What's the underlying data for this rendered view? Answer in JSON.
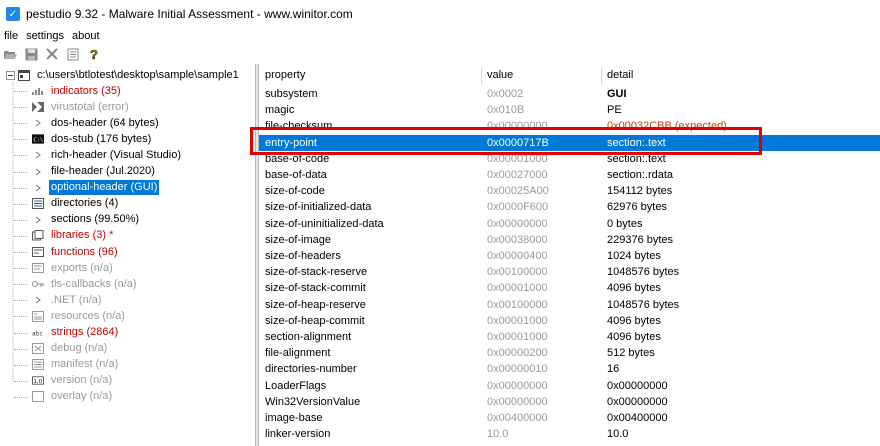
{
  "window": {
    "title": "pestudio 9.32 - Malware Initial Assessment - www.winitor.com"
  },
  "menu": [
    "file",
    "settings",
    "about"
  ],
  "tree": {
    "root": "c:\\users\\btlotest\\desktop\\sample\\sample1",
    "items": [
      {
        "label": "indicators (35)",
        "style": "red",
        "icon": "indicators-icon"
      },
      {
        "label": "virustotal (error)",
        "style": "gray",
        "icon": "virustotal-icon"
      },
      {
        "label": "dos-header (64 bytes)",
        "style": "normal",
        "icon": "expander-icon"
      },
      {
        "label": "dos-stub (176 bytes)",
        "style": "normal",
        "icon": "console-icon"
      },
      {
        "label": "rich-header (Visual Studio)",
        "style": "normal",
        "icon": "expander-icon"
      },
      {
        "label": "file-header (Jul.2020)",
        "style": "normal",
        "icon": "expander-icon"
      },
      {
        "label": "optional-header (GUI)",
        "style": "selected",
        "icon": "expander-icon"
      },
      {
        "label": "directories (4)",
        "style": "normal",
        "icon": "directories-icon"
      },
      {
        "label": "sections (99.50%)",
        "style": "normal",
        "icon": "expander-icon"
      },
      {
        "label": "libraries (3) *",
        "style": "red",
        "icon": "libraries-icon"
      },
      {
        "label": "functions (96)",
        "style": "red",
        "icon": "functions-icon"
      },
      {
        "label": "exports (n/a)",
        "style": "gray",
        "icon": "exports-icon"
      },
      {
        "label": "tls-callbacks (n/a)",
        "style": "gray",
        "icon": "tls-callbacks-icon"
      },
      {
        "label": ".NET (n/a)",
        "style": "gray",
        "icon": "expander-icon"
      },
      {
        "label": "resources (n/a)",
        "style": "gray",
        "icon": "resources-icon"
      },
      {
        "label": "strings (2864)",
        "style": "red",
        "icon": "strings-icon"
      },
      {
        "label": "debug (n/a)",
        "style": "gray",
        "icon": "debug-icon"
      },
      {
        "label": "manifest (n/a)",
        "style": "gray",
        "icon": "manifest-icon"
      },
      {
        "label": "version (n/a)",
        "style": "gray",
        "icon": "version-icon"
      },
      {
        "label": "overlay (n/a)",
        "style": "gray",
        "icon": "overlay-icon"
      }
    ]
  },
  "table": {
    "headers": [
      "property",
      "value",
      "detail"
    ],
    "rows": [
      {
        "property": "subsystem",
        "value": "0x0002",
        "detail": "GUI",
        "detail_bold": true
      },
      {
        "property": "magic",
        "value": "0x010B",
        "detail": "PE"
      },
      {
        "property": "file-checksum",
        "value": "0x00000000",
        "detail": "0x00032CBB (expected)",
        "detail_red": true
      },
      {
        "property": "entry-point",
        "value": "0x0000717B",
        "detail": "section:.text",
        "selected": true
      },
      {
        "property": "base-of-code",
        "value": "0x00001000",
        "detail": "section:.text"
      },
      {
        "property": "base-of-data",
        "value": "0x00027000",
        "detail": "section:.rdata"
      },
      {
        "property": "size-of-code",
        "value": "0x00025A00",
        "detail": "154112 bytes"
      },
      {
        "property": "size-of-initialized-data",
        "value": "0x0000F600",
        "detail": "62976 bytes"
      },
      {
        "property": "size-of-uninitialized-data",
        "value": "0x00000000",
        "detail": "0 bytes"
      },
      {
        "property": "size-of-image",
        "value": "0x00038000",
        "detail": "229376 bytes"
      },
      {
        "property": "size-of-headers",
        "value": "0x00000400",
        "detail": "1024 bytes"
      },
      {
        "property": "size-of-stack-reserve",
        "value": "0x00100000",
        "detail": "1048576 bytes"
      },
      {
        "property": "size-of-stack-commit",
        "value": "0x00001000",
        "detail": "4096 bytes"
      },
      {
        "property": "size-of-heap-reserve",
        "value": "0x00100000",
        "detail": "1048576 bytes"
      },
      {
        "property": "size-of-heap-commit",
        "value": "0x00001000",
        "detail": "4096 bytes"
      },
      {
        "property": "section-alignment",
        "value": "0x00001000",
        "detail": "4096 bytes"
      },
      {
        "property": "file-alignment",
        "value": "0x00000200",
        "detail": "512 bytes"
      },
      {
        "property": "directories-number",
        "value": "0x00000010",
        "detail": "16"
      },
      {
        "property": "LoaderFlags",
        "value": "0x00000000",
        "detail": "0x00000000"
      },
      {
        "property": "Win32VersionValue",
        "value": "0x00000000",
        "detail": "0x00000000"
      },
      {
        "property": "image-base",
        "value": "0x00400000",
        "detail": "0x00400000"
      },
      {
        "property": "linker-version",
        "value": "10.0",
        "detail": "10.0"
      }
    ]
  },
  "colors": {
    "selection": "#0078d7",
    "indicator_red": "#c00000",
    "highlight_box": "#e00000"
  }
}
